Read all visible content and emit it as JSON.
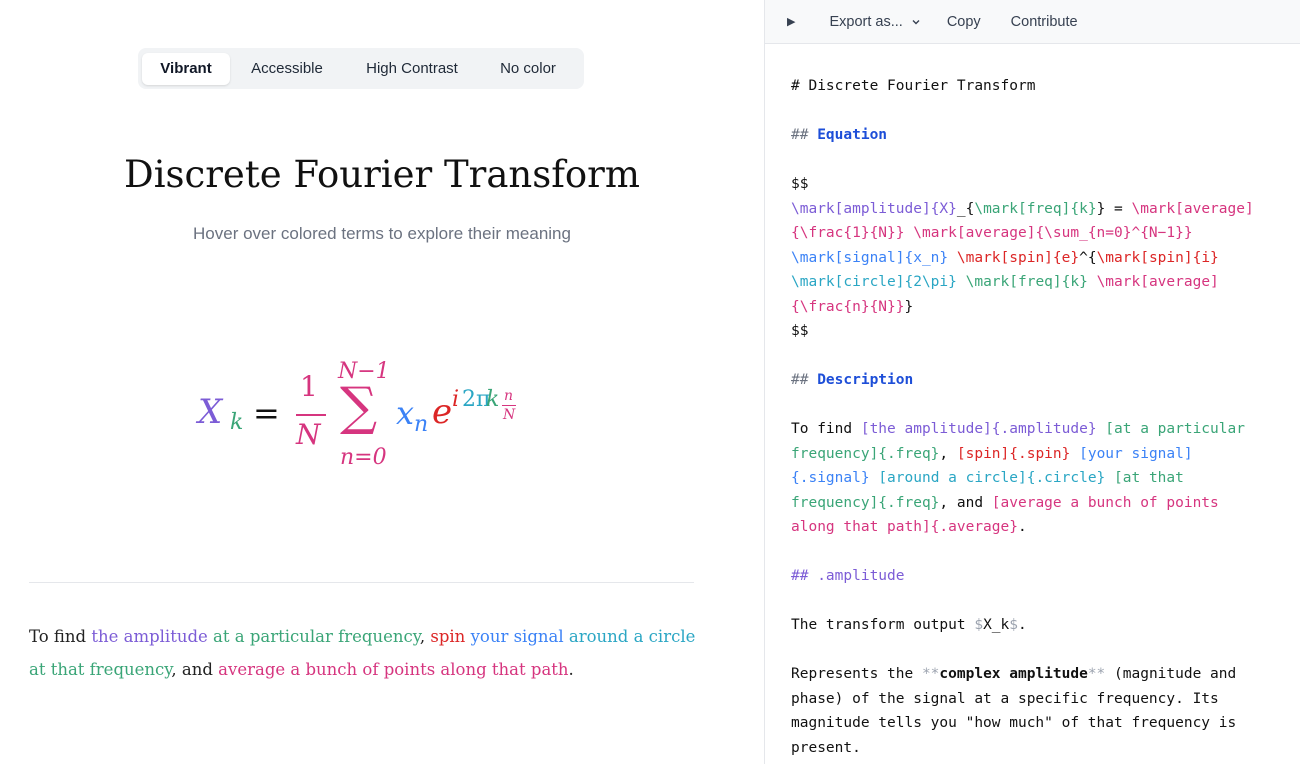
{
  "colors": {
    "amplitude": "#7c5cd6",
    "freq": "#3aa577",
    "average": "#d6357f",
    "signal": "#3b82f6",
    "spin": "#dc2626",
    "circle": "#2aa6c4"
  },
  "palette": {
    "options": [
      "Vibrant",
      "Accessible",
      "High Contrast",
      "No color"
    ],
    "selected": "Vibrant"
  },
  "main": {
    "title": "Discrete Fourier Transform",
    "subtitle": "Hover over colored terms to explore their meaning"
  },
  "equation": {
    "X": "X",
    "k_sub": "k",
    "eq": "=",
    "one": "1",
    "N_den": "N",
    "sum_top": "N−1",
    "sum": "∑",
    "sum_bottom": "n=0",
    "x": "x",
    "n_sub": "n",
    "e": "e",
    "i": "i",
    "two_pi": "2π",
    "k": "k",
    "frac_n": "n",
    "frac_N": "N"
  },
  "description": {
    "pre": "To find ",
    "amplitude": "the amplitude",
    "freq1": "at a particular frequency",
    "comma1": ", ",
    "spin": "spin",
    "signal": "your signal",
    "circle": "around a circle",
    "freq2": "at that frequency",
    "and": ", and ",
    "average": "average a bunch of points along that path",
    "end": "."
  },
  "toolbar": {
    "run_icon": "▶",
    "export_label": "Export as...",
    "export_chevron": "chevron-down-icon",
    "copy_label": "Copy",
    "contribute_label": "Contribute"
  },
  "code": {
    "l1": "# Discrete Fourier Transform",
    "h2_eq_hash": "## ",
    "h2_eq": "Equation",
    "dollars": "$$",
    "eq1_a": "\\mark[amplitude]{X}",
    "eq1_b": "_{",
    "eq1_c": "\\mark[freq]{k}",
    "eq1_d": "} = ",
    "eq1_e": "\\mark[average]",
    "eq2_a": "{\\frac{1}{N}}",
    "eq2_b": " ",
    "eq2_c": "\\mark[average]{\\sum_{n=0}^{N−1}}",
    "eq3_a": "\\mark[signal]{x_n}",
    "eq3_b": " ",
    "eq3_c": "\\mark[spin]{e}",
    "eq3_d": "^{",
    "eq3_e": "\\mark[spin]{i}",
    "eq4_a": "\\mark[circle]{2\\pi}",
    "eq4_b": " ",
    "eq4_c": "\\mark[freq]{k}",
    "eq4_d": " ",
    "eq4_e": "\\mark[average]",
    "eq5_a": "{\\frac{n}{N}}",
    "eq5_b": "}",
    "h2_desc_hash": "## ",
    "h2_desc": "Description",
    "d1_a": "To find ",
    "d1_b": "[the amplitude]{.amplitude}",
    "d1_c": " ",
    "d1_d": "[at a particular",
    "d2_a": "frequency]{.freq}",
    "d2_b": ", ",
    "d2_c": "[spin]{.spin}",
    "d2_d": " ",
    "d2_e": "[your signal]",
    "d3_a": "{.signal}",
    "d3_b": " ",
    "d3_c": "[around a circle]{.circle}",
    "d3_d": " ",
    "d3_e": "[at that",
    "d4_a": "frequency]{.freq}",
    "d4_b": ", and ",
    "d4_c": "[average a bunch of points",
    "d5_a": "along that path]{.average}",
    "d5_b": ".",
    "h2_amp": "## .amplitude",
    "t1_a": "The transform output ",
    "t1_b": "$",
    "t1_c": "X_k",
    "t1_d": "$",
    "t1_e": ".",
    "r1_a": "Represents the ",
    "r1_b": "**",
    "r1_c": "complex amplitude",
    "r1_d": "**",
    "r1_e": " (magnitude and",
    "r2": "phase) of the signal at a specific frequency. Its",
    "r3": "magnitude tells you \"how much\" of that frequency is",
    "r4": "present."
  }
}
